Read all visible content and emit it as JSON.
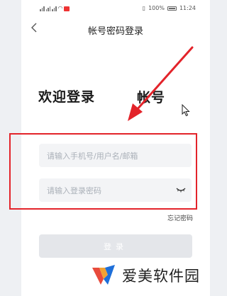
{
  "status_bar": {
    "signal_left": "5G",
    "battery_percent": "100%",
    "time": "11:24"
  },
  "nav": {
    "title": "帐号密码登录",
    "back_icon": "chevron-left-icon"
  },
  "heading": {
    "welcome": "欢迎登录",
    "account": "帐号"
  },
  "form": {
    "username_placeholder": "请输入手机号/用户名/邮箱",
    "password_placeholder": "请输入登录密码",
    "forgot_password": "忘记密码",
    "login_label": "登录",
    "eye_icon": "eye-closed-icon"
  },
  "annotation": {
    "color": "#e3232a",
    "arrow_icon": "red-arrow-icon"
  },
  "watermark": {
    "text": "爱美软件园"
  },
  "colors": {
    "field_bg": "#f3f4f6",
    "button_disabled": "#e4e6ea",
    "placeholder": "#aab0b8"
  }
}
